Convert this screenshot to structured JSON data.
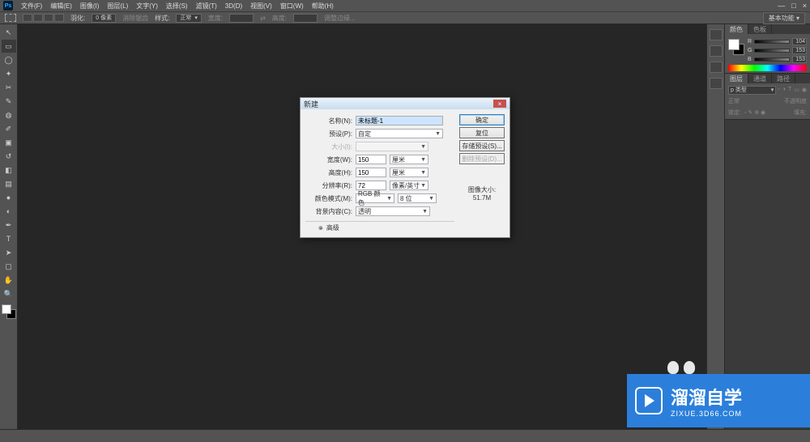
{
  "menubar": {
    "items": [
      "文件(F)",
      "编辑(E)",
      "图像(I)",
      "图层(L)",
      "文字(Y)",
      "选择(S)",
      "滤镜(T)",
      "3D(D)",
      "视图(V)",
      "窗口(W)",
      "帮助(H)"
    ]
  },
  "optionsbar": {
    "feather_label": "羽化:",
    "feather_value": "0 像素",
    "antialias": "消除锯齿",
    "style_label": "样式:",
    "style_value": "正常",
    "width_label": "宽度:",
    "height_label": "高度:",
    "refine": "调整边缘...",
    "right_label": "基本功能"
  },
  "right": {
    "color_tab": "颜色",
    "swatches_tab": "色板",
    "sliders": [
      {
        "label": "R",
        "value": "104"
      },
      {
        "label": "G",
        "value": "153"
      },
      {
        "label": "B",
        "value": "153"
      }
    ],
    "layers_tab": "图层",
    "channels_tab": "通道",
    "paths_tab": "路径",
    "blend_mode": "p 类型",
    "opacity_label": "不透明度",
    "lock_label": "锁定:",
    "fill_label": "填充:"
  },
  "dialog": {
    "title": "新建",
    "name_label": "名称(N):",
    "name_value": "未标题-1",
    "preset_label": "预设(P):",
    "preset_value": "自定",
    "size_label": "大小(I):",
    "width_label": "宽度(W):",
    "width_value": "150",
    "width_unit": "厘米",
    "height_label": "高度(H):",
    "height_value": "150",
    "height_unit": "厘米",
    "res_label": "分辨率(R):",
    "res_value": "72",
    "res_unit": "像素/英寸",
    "mode_label": "颜色模式(M):",
    "mode_value": "RGB 颜色",
    "bit_value": "8 位",
    "bg_label": "背景内容(C):",
    "bg_value": "透明",
    "advanced": "高级",
    "ok": "确定",
    "cancel": "复位",
    "save_preset": "存储预设(S)...",
    "delete_preset": "删除预设(D)...",
    "imgsize_label": "图像大小:",
    "imgsize_value": "51.7M"
  },
  "watermark": {
    "big": "溜溜自学",
    "small": "ZIXUE.3D66.COM"
  }
}
